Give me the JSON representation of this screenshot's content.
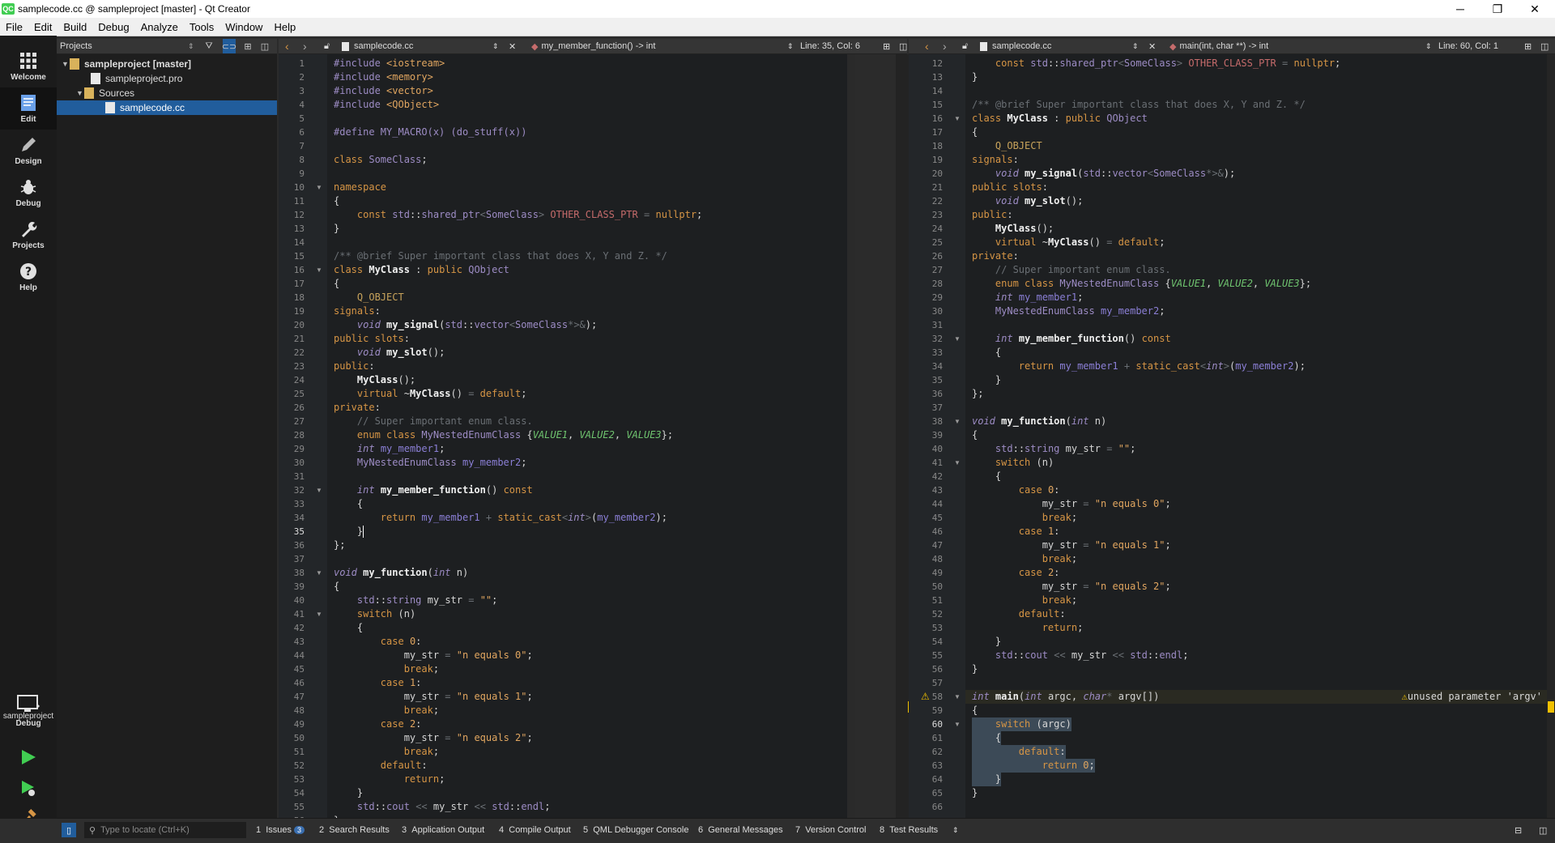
{
  "window": {
    "title": "samplecode.cc @ sampleproject [master] - Qt Creator",
    "app_icon": "QC",
    "minimize": "─",
    "restore": "❐",
    "close": "✕"
  },
  "menu": [
    "File",
    "Edit",
    "Build",
    "Debug",
    "Analyze",
    "Tools",
    "Window",
    "Help"
  ],
  "modes": [
    {
      "label": "Welcome",
      "icon": "grid-icon"
    },
    {
      "label": "Edit",
      "icon": "document-icon",
      "active": true
    },
    {
      "label": "Design",
      "icon": "pencil-icon"
    },
    {
      "label": "Debug",
      "icon": "bug-icon"
    },
    {
      "label": "Projects",
      "icon": "wrench-icon"
    },
    {
      "label": "Help",
      "icon": "help-icon"
    }
  ],
  "kit": {
    "project": "sampleproject",
    "mode": "Debug"
  },
  "projects_pane": {
    "title": "Projects",
    "tree": [
      {
        "label": "sampleproject [master]",
        "level": 0,
        "bold": true,
        "expanded": true
      },
      {
        "label": "sampleproject.pro",
        "level": 1
      },
      {
        "label": "Sources",
        "level": 1,
        "expanded": true
      },
      {
        "label": "samplecode.cc",
        "level": 2,
        "selected": true
      }
    ]
  },
  "left_editor": {
    "file": "samplecode.cc",
    "symbol": "my_member_function() -> int",
    "position": "Line: 35, Col: 6",
    "current_line": 35,
    "first_line": 1
  },
  "right_editor": {
    "file": "samplecode.cc",
    "symbol": "main(int, char **) -> int",
    "position": "Line: 60, Col: 1",
    "current_line": 60,
    "first_line": 12,
    "warning_line": 58,
    "warning_text": "unused parameter 'argv'"
  },
  "code_lines": [
    "#include <iostream>",
    "#include <memory>",
    "#include <vector>",
    "#include <QObject>",
    "",
    "#define MY_MACRO(x) (do_stuff(x))",
    "",
    "class SomeClass;",
    "",
    "namespace",
    "{",
    "    const std::shared_ptr<SomeClass> OTHER_CLASS_PTR = nullptr;",
    "}",
    "",
    "/** @brief Super important class that does X, Y and Z. */",
    "class MyClass : public QObject",
    "{",
    "    Q_OBJECT",
    "signals:",
    "    void my_signal(std::vector<SomeClass*>&);",
    "public slots:",
    "    void my_slot();",
    "public:",
    "    MyClass();",
    "    virtual ~MyClass() = default;",
    "private:",
    "    // Super important enum class.",
    "    enum class MyNestedEnumClass {VALUE1, VALUE2, VALUE3};",
    "    int my_member1;",
    "    MyNestedEnumClass my_member2;",
    "",
    "    int my_member_function() const",
    "    {",
    "        return my_member1 + static_cast<int>(my_member2);",
    "    }",
    "};",
    "",
    "void my_function(int n)",
    "{",
    "    std::string my_str = \"\";",
    "    switch (n)",
    "    {",
    "        case 0:",
    "            my_str = \"n equals 0\";",
    "            break;",
    "        case 1:",
    "            my_str = \"n equals 1\";",
    "            break;",
    "        case 2:",
    "            my_str = \"n equals 2\";",
    "            break;",
    "        default:",
    "            return;",
    "    }",
    "    std::cout << my_str << std::endl;",
    "}",
    "",
    "int main(int argc, char* argv[])",
    "{",
    "    switch (argc)",
    "    {",
    "        default:",
    "            return 0;",
    "    }",
    "}",
    ""
  ],
  "fold_lines": [
    10,
    16,
    32,
    38,
    41,
    58,
    60
  ],
  "locator": {
    "placeholder": "Type to locate (Ctrl+K)"
  },
  "output_tabs": [
    {
      "num": "1",
      "label": "Issues",
      "badge": "3"
    },
    {
      "num": "2",
      "label": "Search Results"
    },
    {
      "num": "3",
      "label": "Application Output"
    },
    {
      "num": "4",
      "label": "Compile Output"
    },
    {
      "num": "5",
      "label": "QML Debugger Console"
    },
    {
      "num": "6",
      "label": "General Messages"
    },
    {
      "num": "7",
      "label": "Version Control"
    },
    {
      "num": "8",
      "label": "Test Results"
    }
  ],
  "colors": {
    "accent": "#215d9c",
    "warning": "#f0c000",
    "run": "#41cd52"
  }
}
